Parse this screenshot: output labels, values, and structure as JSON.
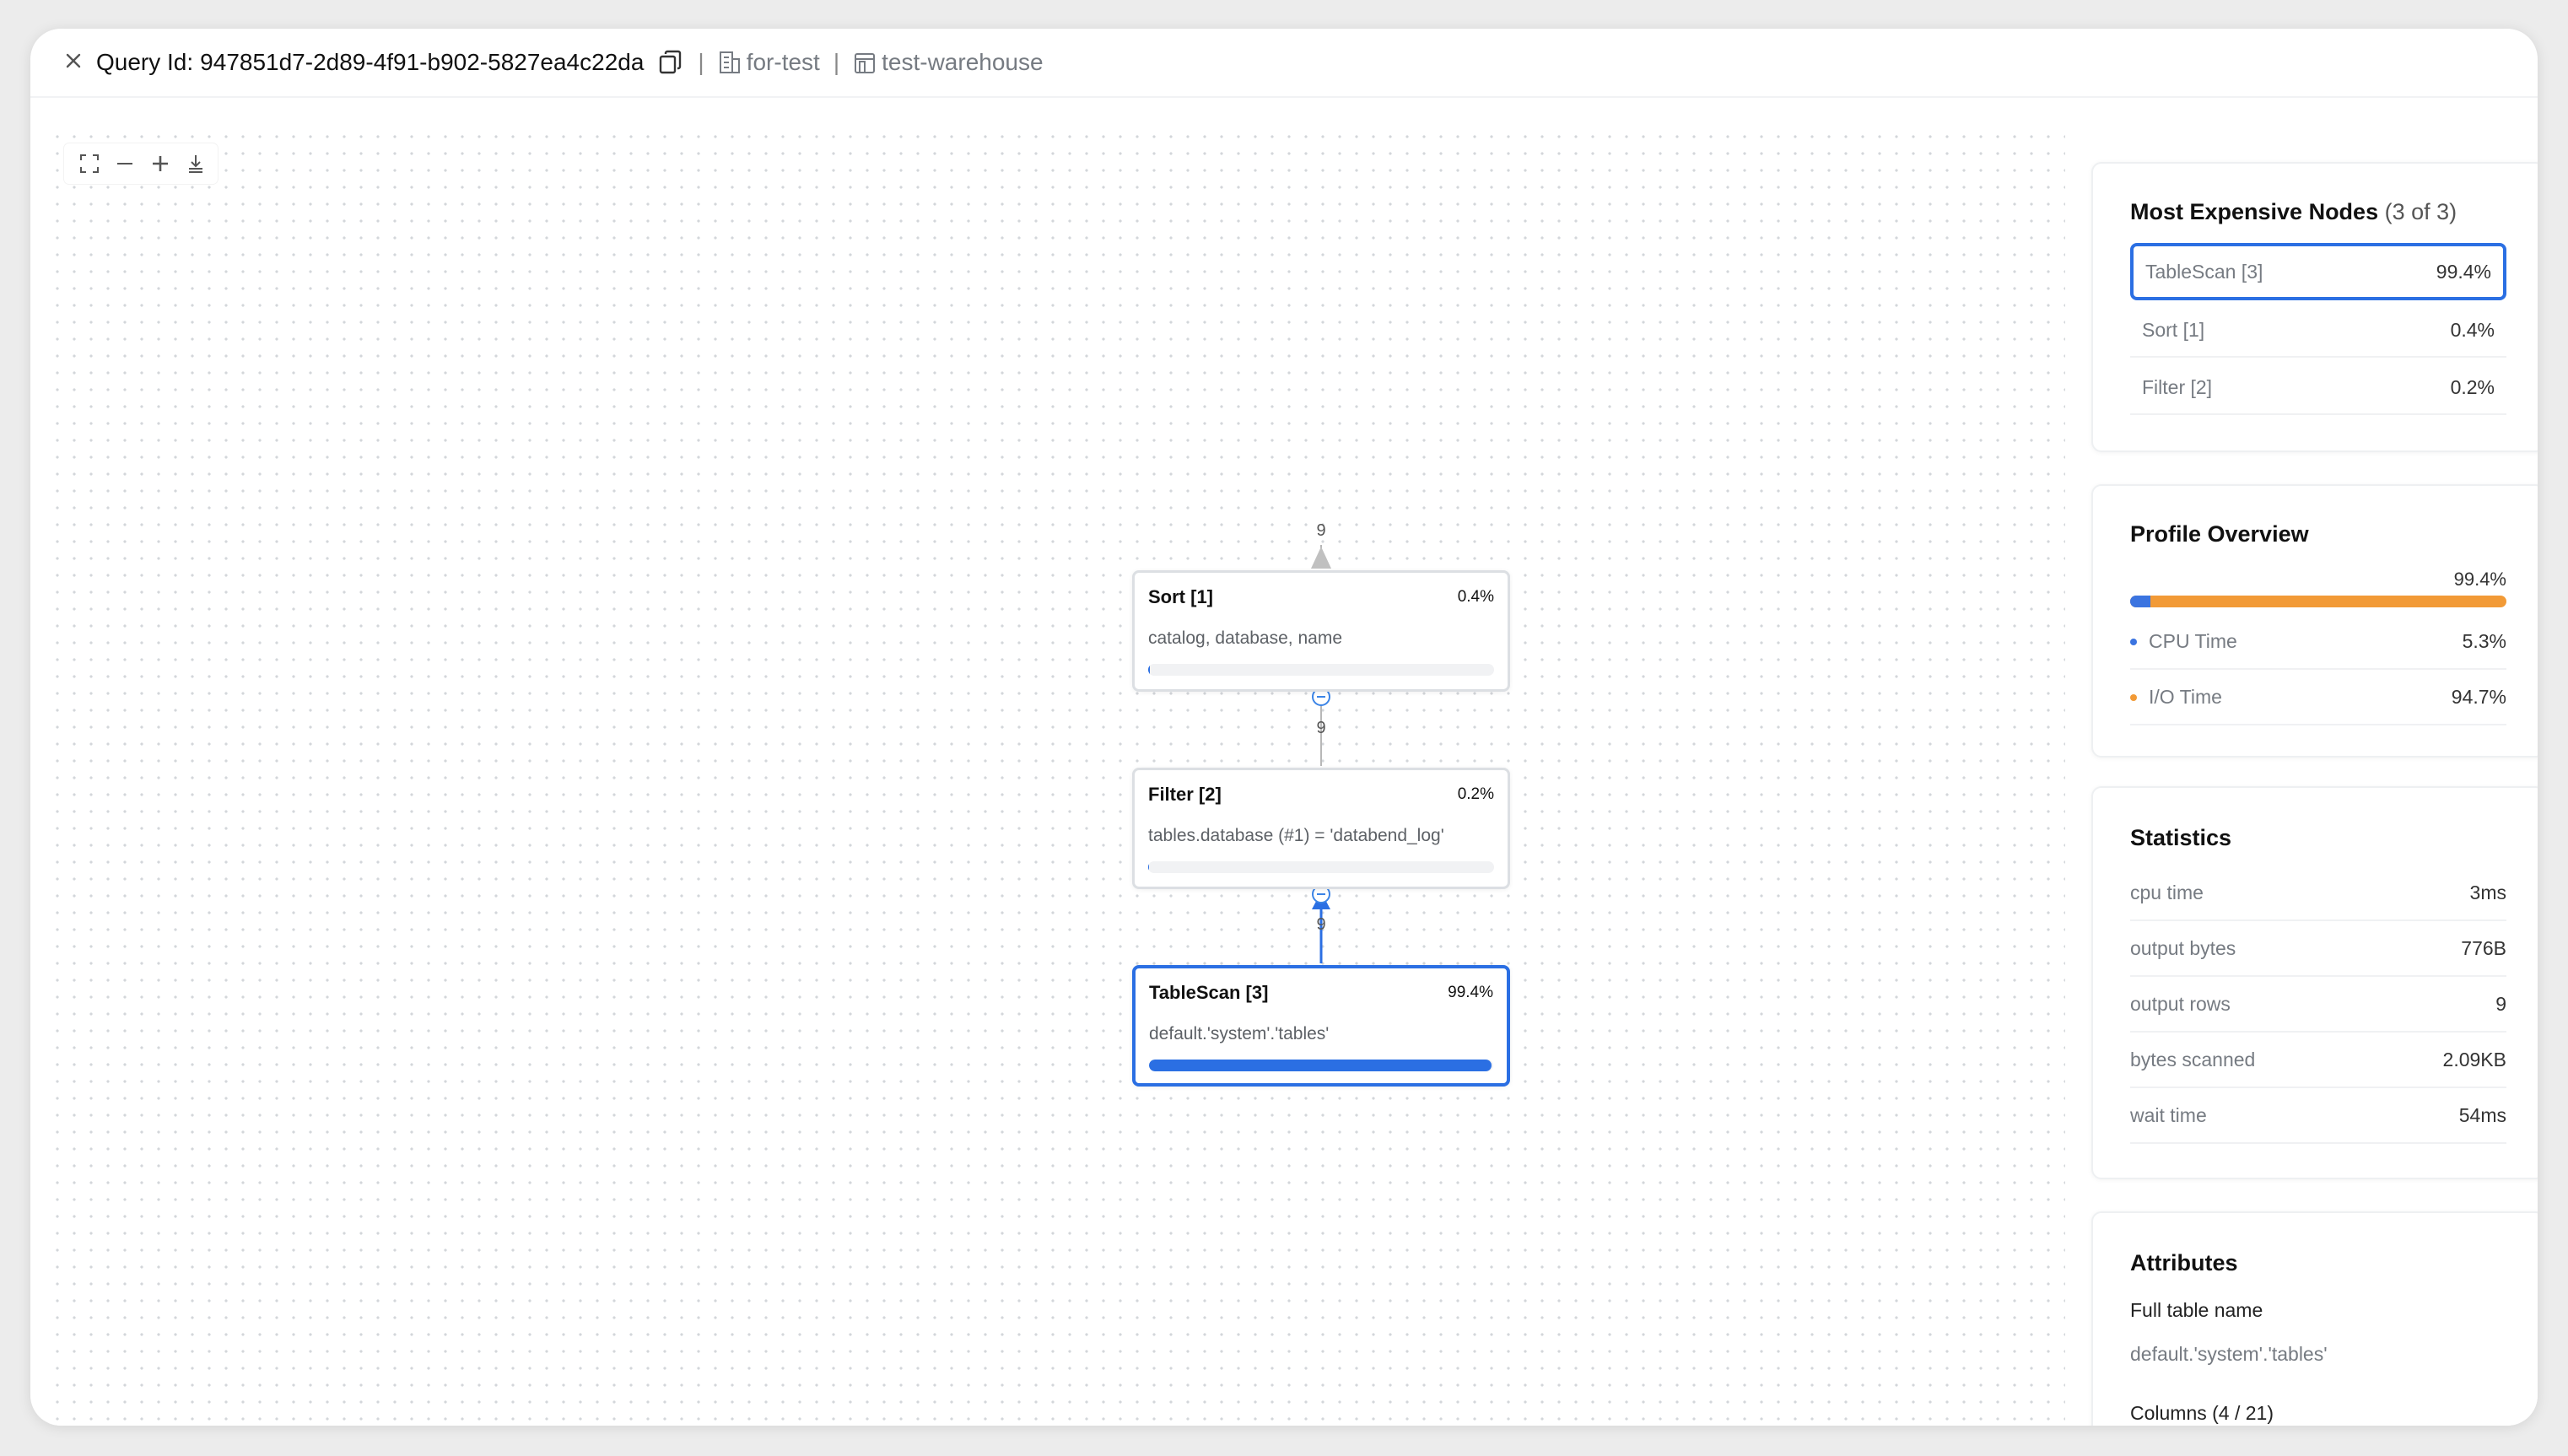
{
  "header": {
    "query_label": "Query Id:",
    "query_id": "947851d7-2d89-4f91-b902-5827ea4c22da",
    "separator": "|",
    "tenant": "for-test",
    "warehouse": "test-warehouse"
  },
  "graph": {
    "nodes": [
      {
        "title": "Sort [1]",
        "percent": "0.4%",
        "description": "catalog, database, name",
        "bar_fraction": 0.004
      },
      {
        "title": "Filter [2]",
        "percent": "0.2%",
        "description": "tables.database (#1) = 'databend_log'",
        "bar_fraction": 0.002
      },
      {
        "title": "TableScan [3]",
        "percent": "99.4%",
        "description": "default.'system'.'tables'",
        "bar_fraction": 0.994
      }
    ],
    "edge_labels": [
      "9",
      "9",
      "9"
    ]
  },
  "expensive": {
    "title": "Most Expensive Nodes",
    "count": "(3 of 3)",
    "items": [
      {
        "name": "TableScan [3]",
        "value": "99.4%"
      },
      {
        "name": "Sort [1]",
        "value": "0.4%"
      },
      {
        "name": "Filter [2]",
        "value": "0.2%"
      }
    ]
  },
  "profile": {
    "title": "Profile Overview",
    "total": "99.4%",
    "cpu_fraction": 0.053,
    "items": [
      {
        "name": "CPU Time",
        "value": "5.3%",
        "color": "#3b74e0"
      },
      {
        "name": "I/O Time",
        "value": "94.7%",
        "color": "#f29a36"
      }
    ]
  },
  "statistics": {
    "title": "Statistics",
    "items": [
      {
        "name": "cpu time",
        "value": "3ms"
      },
      {
        "name": "output bytes",
        "value": "776B"
      },
      {
        "name": "output rows",
        "value": "9"
      },
      {
        "name": "bytes scanned",
        "value": "2.09KB"
      },
      {
        "name": "wait time",
        "value": "54ms"
      }
    ]
  },
  "attributes": {
    "title": "Attributes",
    "full_table_label": "Full table name",
    "full_table_value": "default.'system'.'tables'",
    "columns_label": "Columns (4 / 21)"
  },
  "colors": {
    "accent": "#2b6fe3",
    "io": "#f29a36",
    "cpu": "#3b74e0"
  }
}
